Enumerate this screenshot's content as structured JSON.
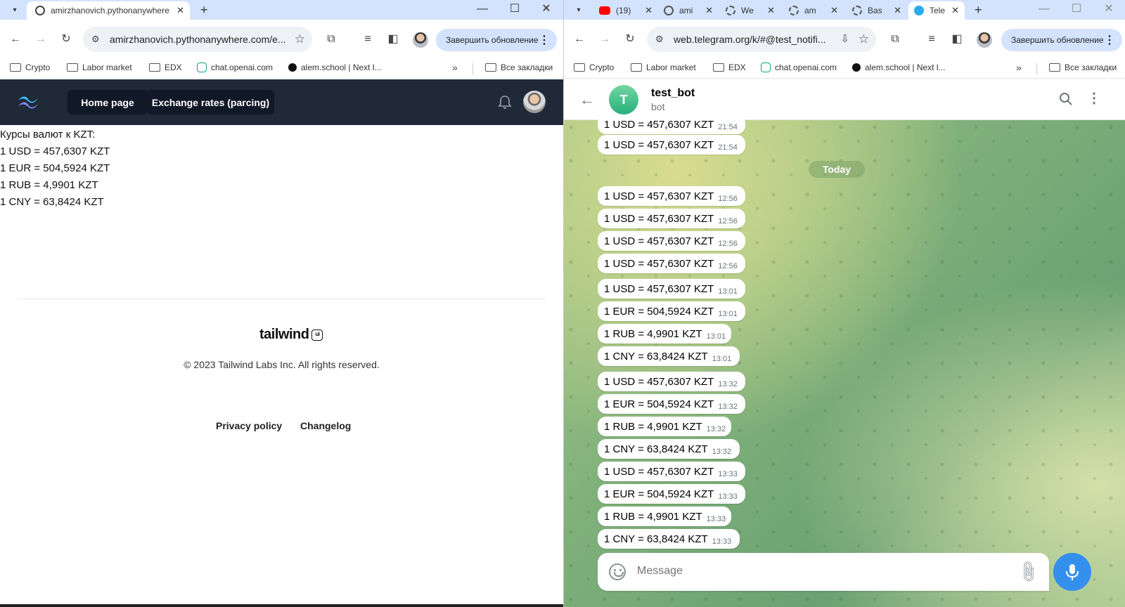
{
  "left": {
    "tabs": [
      {
        "title": "amirzhanovich.pythonanywhere"
      }
    ],
    "url": "amirzhanovich.pythonanywhere.com/e...",
    "update_label": "Завершить обновление",
    "bookmarks": [
      "Crypto",
      "Labor market",
      "EDX",
      "chat.openai.com",
      "alem.school | Next l..."
    ],
    "all_bookmarks": "Все закладки",
    "nav": {
      "home": "Home page",
      "exchange": "Exchange rates (parcing)"
    },
    "rates_title": "Курсы валют к KZT:",
    "rates": [
      "1 USD = 457,6307 KZT",
      "1 EUR = 504,5924 KZT",
      "1 RUB = 4,9901 KZT",
      "1 CNY = 63,8424 KZT"
    ],
    "footer": {
      "logo": "tailwind",
      "logo_badge": "ui",
      "copyright": "© 2023 Tailwind Labs Inc. All rights reserved.",
      "privacy": "Privacy policy",
      "changelog": "Changelog"
    }
  },
  "right": {
    "tabs": [
      {
        "title": "(19)",
        "icon": "youtube-icon"
      },
      {
        "title": "ami",
        "icon": "globe-icon"
      },
      {
        "title": "We",
        "icon": "replit-icon"
      },
      {
        "title": "am",
        "icon": "replit-icon"
      },
      {
        "title": "Bas",
        "icon": "replit-icon"
      },
      {
        "title": "Tele",
        "icon": "telegram-icon"
      }
    ],
    "url": "web.telegram.org/k/#@test_notifi...",
    "update_label": "Завершить обновление",
    "bookmarks": [
      "Crypto",
      "Labor market",
      "EDX",
      "chat.openai.com",
      "alem.school | Next l..."
    ],
    "all_bookmarks": "Все закладки",
    "chat": {
      "name": "test_bot",
      "status": "bot",
      "avatar_letter": "T",
      "date_divider": "Today",
      "messages": [
        {
          "text": "1 USD = 457,6307 KZT",
          "time": "21:54"
        },
        {
          "text": "1 USD = 457,6307 KZT",
          "time": "21:54"
        },
        {
          "text": "1 USD = 457,6307 KZT",
          "time": "12:56"
        },
        {
          "text": "1 USD = 457,6307 KZT",
          "time": "12:56"
        },
        {
          "text": "1 USD = 457,6307 KZT",
          "time": "12:56"
        },
        {
          "text": "1 USD = 457,6307 KZT",
          "time": "12:56"
        },
        {
          "text": "1 USD = 457,6307 KZT",
          "time": "13:01"
        },
        {
          "text": "1 EUR = 504,5924 KZT",
          "time": "13:01"
        },
        {
          "text": "1 RUB = 4,9901 KZT",
          "time": "13:01"
        },
        {
          "text": "1 CNY = 63,8424 KZT",
          "time": "13:01"
        },
        {
          "text": "1 USD = 457,6307 KZT",
          "time": "13:32"
        },
        {
          "text": "1 EUR = 504,5924 KZT",
          "time": "13:32"
        },
        {
          "text": "1 RUB = 4,9901 KZT",
          "time": "13:32"
        },
        {
          "text": "1 CNY = 63,8424 KZT",
          "time": "13:32"
        },
        {
          "text": "1 USD = 457,6307 KZT",
          "time": "13:33"
        },
        {
          "text": "1 EUR = 504,5924 KZT",
          "time": "13:33"
        },
        {
          "text": "1 RUB = 4,9901 KZT",
          "time": "13:33"
        },
        {
          "text": "1 CNY = 63,8424 KZT",
          "time": "13:33"
        }
      ],
      "input_placeholder": "Message"
    }
  },
  "colors": {
    "tabbar": "#d3e3fd",
    "navbar": "#1f2937",
    "telegram_blue": "#3390ec",
    "tg_avatar": "#27b07d"
  }
}
